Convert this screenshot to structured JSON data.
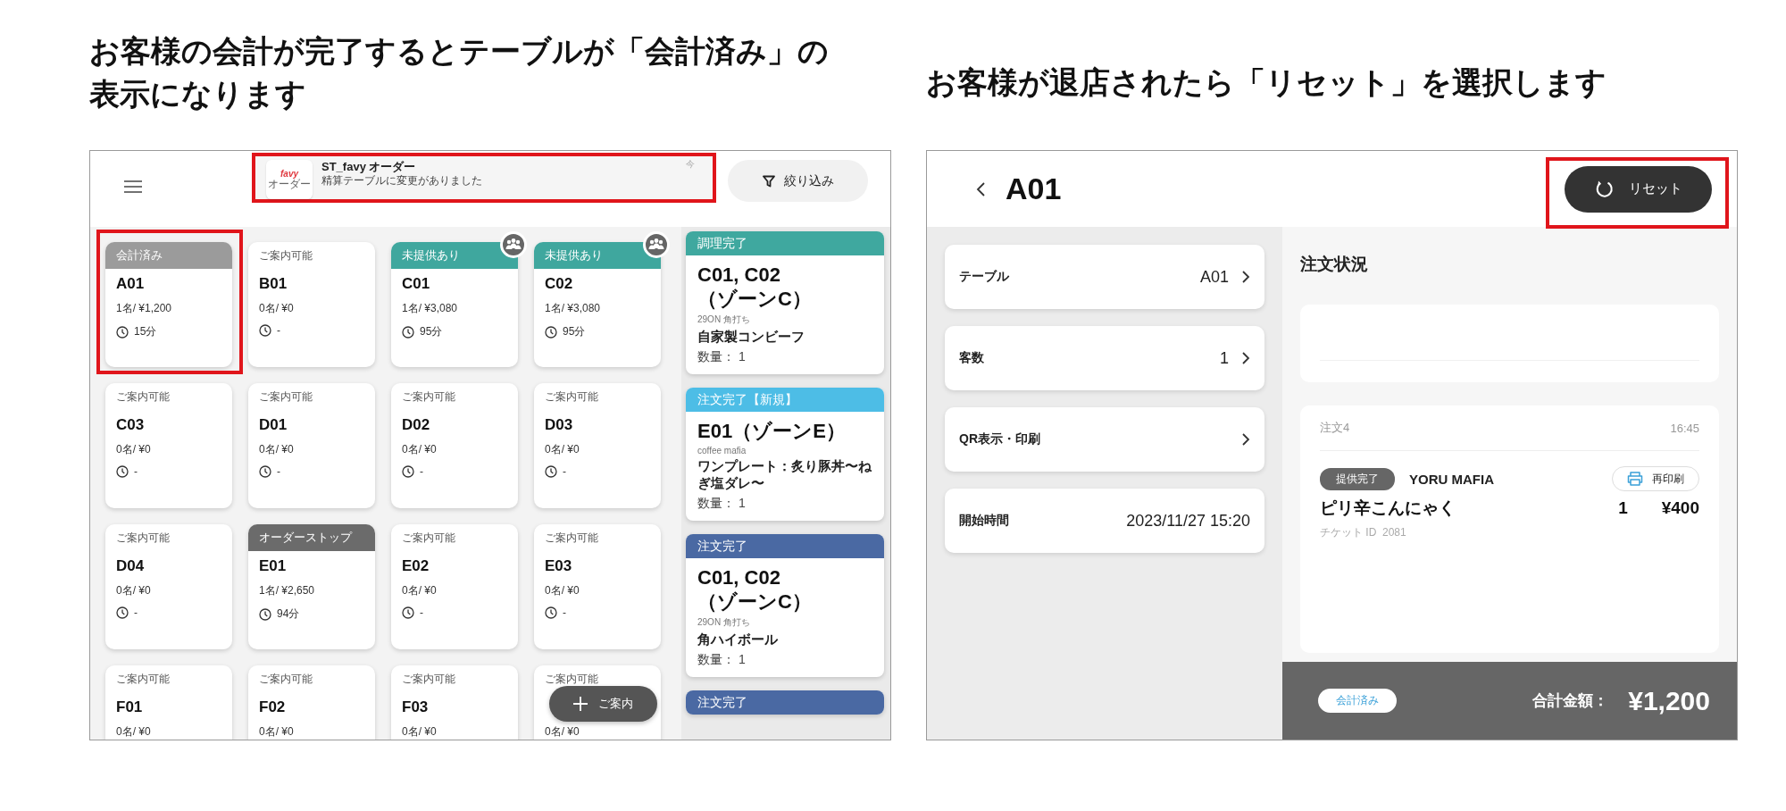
{
  "captions": [
    {
      "text": "お客様の会計が完了するとテーブルが「会計済み」の表示になります"
    },
    {
      "text": "お客様が退店されたら「リセット」を選択します"
    }
  ],
  "floor": {
    "notification": {
      "logo": "favy",
      "logo_sub": "オーダー",
      "app": "ST_favy オーダー",
      "message": "精算テーブルに変更がありました",
      "time": "今",
      "highlighted": true
    },
    "filter_button": "絞り込み",
    "tables": [
      {
        "kind": "paid",
        "status": "会計済み",
        "name": "A01",
        "guests": "1名/ ¥1,200",
        "time": "15分",
        "badge": false,
        "highlighted": true
      },
      {
        "kind": "available",
        "status": "ご案内可能",
        "name": "B01",
        "guests": "0名/ ¥0",
        "time": "-",
        "badge": false,
        "highlighted": false
      },
      {
        "kind": "unserved",
        "status": "未提供あり",
        "name": "C01",
        "guests": "1名/ ¥3,080",
        "time": "95分",
        "badge": true,
        "highlighted": false
      },
      {
        "kind": "unserved",
        "status": "未提供あり",
        "name": "C02",
        "guests": "1名/ ¥3,080",
        "time": "95分",
        "badge": true,
        "highlighted": false
      },
      {
        "kind": "available",
        "status": "ご案内可能",
        "name": "C03",
        "guests": "0名/ ¥0",
        "time": "-",
        "badge": false,
        "highlighted": false
      },
      {
        "kind": "available",
        "status": "ご案内可能",
        "name": "D01",
        "guests": "0名/ ¥0",
        "time": "-",
        "badge": false,
        "highlighted": false
      },
      {
        "kind": "available",
        "status": "ご案内可能",
        "name": "D02",
        "guests": "0名/ ¥0",
        "time": "-",
        "badge": false,
        "highlighted": false
      },
      {
        "kind": "available",
        "status": "ご案内可能",
        "name": "D03",
        "guests": "0名/ ¥0",
        "time": "-",
        "badge": false,
        "highlighted": false
      },
      {
        "kind": "available",
        "status": "ご案内可能",
        "name": "D04",
        "guests": "0名/ ¥0",
        "time": "-",
        "badge": false,
        "highlighted": false
      },
      {
        "kind": "order_stop",
        "status": "オーダーストップ",
        "name": "E01",
        "guests": "1名/ ¥2,650",
        "time": "94分",
        "badge": false,
        "highlighted": false
      },
      {
        "kind": "available",
        "status": "ご案内可能",
        "name": "E02",
        "guests": "0名/ ¥0",
        "time": "-",
        "badge": false,
        "highlighted": false
      },
      {
        "kind": "available",
        "status": "ご案内可能",
        "name": "E03",
        "guests": "0名/ ¥0",
        "time": "-",
        "badge": false,
        "highlighted": false
      },
      {
        "kind": "available",
        "status": "ご案内可能",
        "name": "F01",
        "guests": "0名/ ¥0",
        "badge": false,
        "highlighted": false
      },
      {
        "kind": "available",
        "status": "ご案内可能",
        "name": "F02",
        "guests": "0名/ ¥0",
        "badge": false,
        "highlighted": false
      },
      {
        "kind": "available",
        "status": "ご案内可能",
        "name": "F03",
        "guests": "0名/ ¥0",
        "badge": false,
        "highlighted": false
      },
      {
        "kind": "available",
        "status": "ご案内可能",
        "guests": "0名/ ¥0",
        "badge": false,
        "highlighted": false
      }
    ],
    "fab": "ご案内",
    "tickets": [
      {
        "status": "調理完了",
        "color": "#3fa89f",
        "table": "C01, C02",
        "zone": "（ゾーンC）",
        "shop": "29ON 角打ち",
        "item": "自家製コンビーフ",
        "qty": "数量： 1"
      },
      {
        "status": "注文完了【新規】",
        "color": "#4dbde6",
        "table": "E01",
        "zone": "（ゾーンE）",
        "shop": "coffee mafia",
        "item": "ワンプレート：炙り豚丼〜ねぎ塩ダレ〜",
        "qty": "数量： 1"
      },
      {
        "status": "注文完了",
        "color": "#4a69a3",
        "table": "C01, C02",
        "zone": "（ゾーンC）",
        "shop": "29ON 角打ち",
        "item": "角ハイボール",
        "qty": "数量： 1"
      },
      {
        "status": "注文完了",
        "color": "#4a69a3"
      }
    ]
  },
  "detail": {
    "title": "A01",
    "reset_button": {
      "label": "リセット",
      "highlighted": true
    },
    "rows": [
      {
        "label": "テーブル",
        "value": "A01",
        "chevron": true
      },
      {
        "label": "客数",
        "value": "1",
        "chevron": true
      },
      {
        "label": "QR表示・印刷",
        "chevron": true
      },
      {
        "label": "開始時間",
        "value": "2023/11/27 15:20",
        "chevron": false
      }
    ],
    "section_title": "注文状況",
    "order": {
      "number": "注文4",
      "time": "16:45",
      "status": "提供完了",
      "shop": "YORU MAFIA",
      "reprint": "再印刷",
      "item": "ピリ辛こんにゃく",
      "ticket": "チケット ID  2081",
      "qty": "1",
      "price": "¥400"
    },
    "footer": {
      "badge": "会計済み",
      "total_label": "合計金額：",
      "total": "¥1,200"
    }
  }
}
